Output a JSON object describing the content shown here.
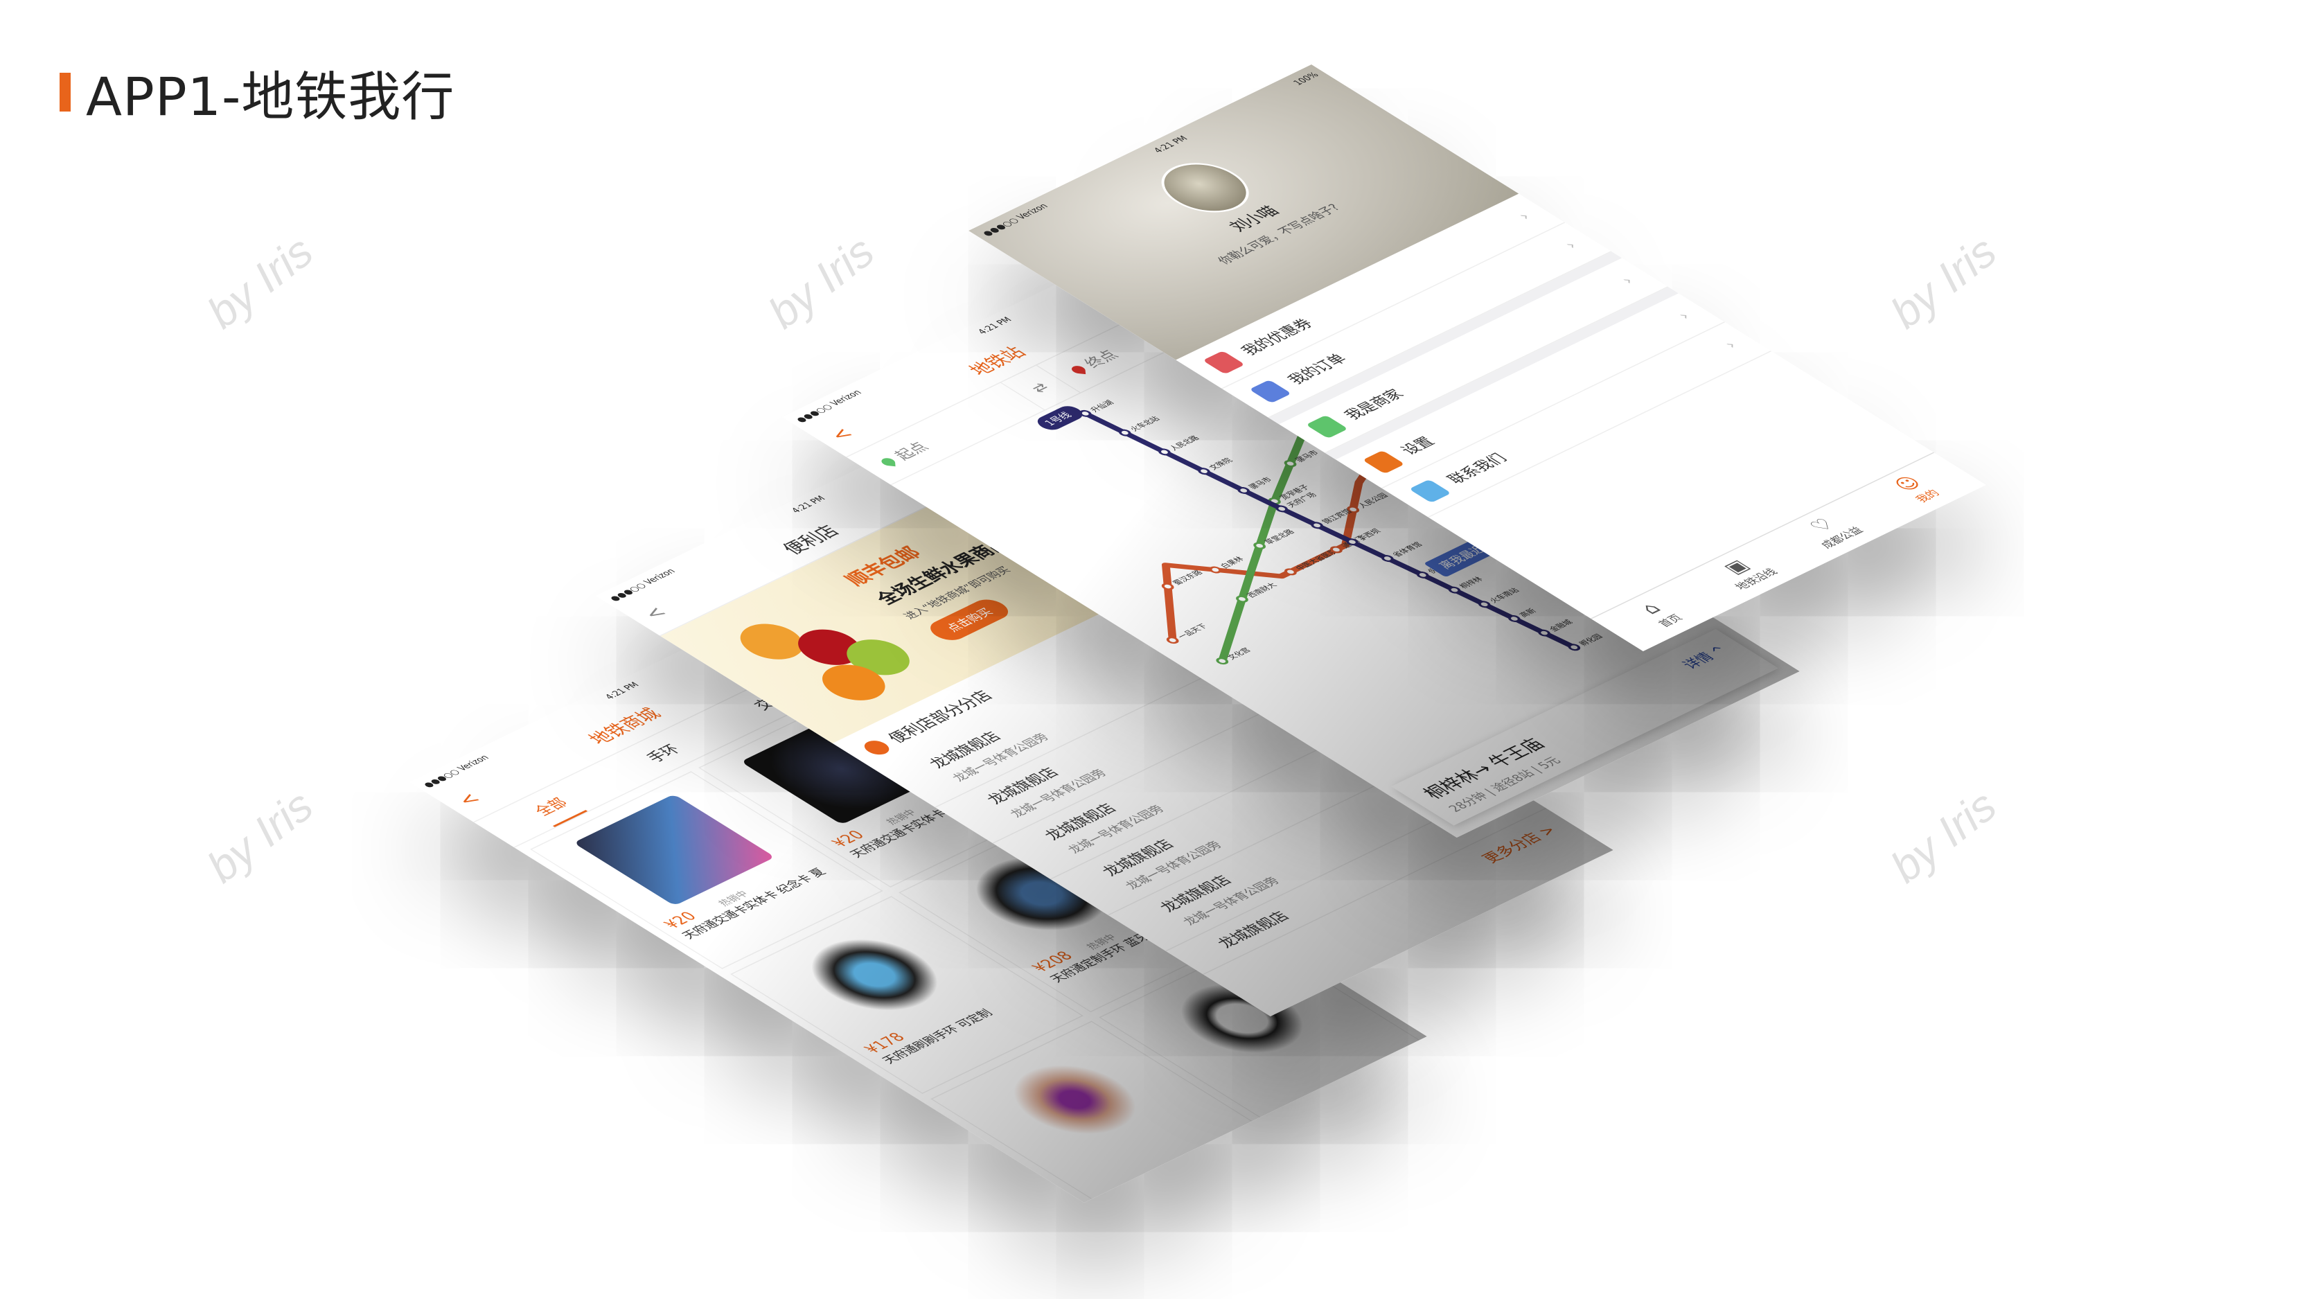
{
  "slide_title": "APP1-地铁我行",
  "watermark": "by Iris",
  "colors": {
    "accent": "#e8641b",
    "line1": "#2d2a6e",
    "line2": "#d4572d",
    "line4": "#5aa84e",
    "link": "#2a4bb0"
  },
  "status": {
    "carrier": "●●●○○ Verizon",
    "time": "4:21 PM",
    "battery": "100%"
  },
  "shop": {
    "title": "地铁商城",
    "back": "<",
    "tabs": [
      "全部",
      "手环",
      "交通卡"
    ],
    "products": [
      {
        "price": "¥20",
        "name": "天府通交通卡实体卡 纪念卡 夏",
        "badge": "热销中"
      },
      {
        "price": "¥20",
        "name": "天府通交通卡实体卡 纪念卡 秋",
        "badge": "热销中"
      },
      {
        "price": "¥178",
        "name": "天府通刷刷手环 可定制",
        "badge": ""
      },
      {
        "price": "¥208",
        "name": "天府通定制手环 蓝牙手环",
        "badge": "热销中"
      }
    ]
  },
  "store": {
    "title": "便利店",
    "back": "<",
    "banner": {
      "line1": "顺丰包邮",
      "line2": "全场生鲜水果商品",
      "line3": "进入“地铁商城”即可购买",
      "button": "点击购买"
    },
    "section": "便利店部分分店",
    "stores": [
      {
        "name": "龙城旗舰店",
        "addr": "龙城一号体育公园旁"
      },
      {
        "name": "龙城旗舰店",
        "addr": "龙城一号体育公园旁"
      },
      {
        "name": "龙城旗舰店",
        "addr": "龙城一号体育公园旁"
      },
      {
        "name": "龙城旗舰店",
        "addr": "龙城一号体育公园旁"
      },
      {
        "name": "龙城旗舰店",
        "addr": "龙城一号体育公园旁"
      },
      {
        "name": "龙城旗舰店",
        "addr": ""
      }
    ],
    "more": "更多分店 >"
  },
  "metro": {
    "title": "地铁站",
    "back": "<",
    "from": "起点",
    "to": "终点",
    "swap": "⇄",
    "line_badge": "1号线",
    "nearest": "离我最近",
    "line1": [
      "升仙湖",
      "火车北站",
      "人民北路",
      "文殊院",
      "骡马市",
      "天府广场",
      "锦江宾馆",
      "华西坝",
      "省体育馆",
      "倪家桥",
      "桐梓林",
      "火车南站",
      "高新",
      "金融城",
      "孵化园"
    ],
    "line2": [
      "一品天下",
      "蜀汉东路",
      "白果林",
      "中医大省医院",
      "通惠门",
      "人民公园",
      "天府广场",
      "春熙路"
    ],
    "line4": [
      "文化宫",
      "西南财大",
      "草堂北路",
      "宽窄巷子",
      "骡马市",
      "太升南路",
      "市二医院"
    ],
    "route": {
      "title": "桐梓林→ 牛王庙",
      "info": "28分钟 | 途径8站 | 5元",
      "detail": "详情 ^"
    }
  },
  "profile": {
    "name": "刘小喵",
    "bio": "你勒么可爱，不写点啥子?",
    "menu": [
      {
        "label": "我的优惠券",
        "color": "#e0565b"
      },
      {
        "label": "我的订单",
        "color": "#5b7fdc"
      },
      {
        "label": "我是商家",
        "color": "#5ec46c"
      },
      {
        "label": "设置",
        "color": "#e8711b"
      },
      {
        "label": "联系我们",
        "color": "#5fb1e8"
      }
    ],
    "tabbar": [
      {
        "label": "首页",
        "icon": "⌂"
      },
      {
        "label": "地铁沿线",
        "icon": "▣"
      },
      {
        "label": "成都公益",
        "icon": "♡"
      },
      {
        "label": "我的",
        "icon": "☺"
      }
    ]
  }
}
